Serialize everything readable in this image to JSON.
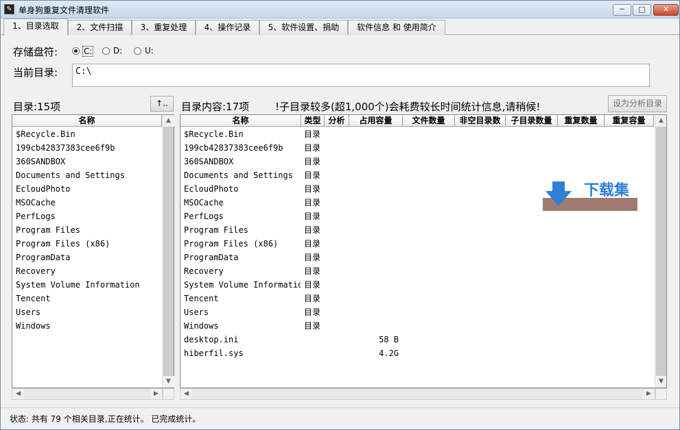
{
  "window": {
    "title": "单身狗重复文件清理软件",
    "min_glyph": "─",
    "max_glyph": "□",
    "close_glyph": "✕",
    "icon_glyph": "✎"
  },
  "tabs": [
    {
      "label": "1、目录选取",
      "active": true
    },
    {
      "label": "2、文件扫描",
      "active": false
    },
    {
      "label": "3、重复处理",
      "active": false
    },
    {
      "label": "4、操作记录",
      "active": false
    },
    {
      "label": "5、软件设置、捐助",
      "active": false
    },
    {
      "label": "软件信息 和 使用简介",
      "active": false
    }
  ],
  "drive": {
    "label": "存储盘符:",
    "options": [
      "C:",
      "D:",
      "U:"
    ],
    "selected": "C:"
  },
  "current_dir": {
    "label": "当前目录:",
    "value": "C:\\"
  },
  "left_panel": {
    "count_label": "目录:15项",
    "up_button": "↑..",
    "header": "名称",
    "items": [
      "$Recycle.Bin",
      "199cb42837383cee6f9b",
      "360SANDBOX",
      "Documents and Settings",
      "EcloudPhoto",
      "MSOCache",
      "PerfLogs",
      "Program Files",
      "Program Files (x86)",
      "ProgramData",
      "Recovery",
      "System Volume Information",
      "Tencent",
      "Users",
      "Windows"
    ]
  },
  "right_panel": {
    "count_label": "目录内容:17项",
    "warning": "!子目录较多(超1,000个)会耗费较长时间统计信息,请稍候!",
    "set_button": "设为分析目录",
    "headers": [
      "名称",
      "类型",
      "分析",
      "占用容量",
      "文件数量",
      "非空目录数",
      "子目录数量",
      "重复数量",
      "重复容量"
    ],
    "rows": [
      {
        "name": "$Recycle.Bin",
        "type": "目录",
        "size": ""
      },
      {
        "name": "199cb42837383cee6f9b",
        "type": "目录",
        "size": ""
      },
      {
        "name": "360SANDBOX",
        "type": "目录",
        "size": ""
      },
      {
        "name": "Documents and Settings",
        "type": "目录",
        "size": ""
      },
      {
        "name": "EcloudPhoto",
        "type": "目录",
        "size": ""
      },
      {
        "name": "MSOCache",
        "type": "目录",
        "size": ""
      },
      {
        "name": "PerfLogs",
        "type": "目录",
        "size": ""
      },
      {
        "name": "Program Files",
        "type": "目录",
        "size": ""
      },
      {
        "name": "Program Files (x86)",
        "type": "目录",
        "size": ""
      },
      {
        "name": "ProgramData",
        "type": "目录",
        "size": ""
      },
      {
        "name": "Recovery",
        "type": "目录",
        "size": ""
      },
      {
        "name": "System Volume Informatio",
        "type": "目录",
        "size": ""
      },
      {
        "name": "Tencent",
        "type": "目录",
        "size": ""
      },
      {
        "name": "Users",
        "type": "目录",
        "size": ""
      },
      {
        "name": "Windows",
        "type": "目录",
        "size": ""
      },
      {
        "name": "desktop.ini",
        "type": "",
        "size": "58 B"
      },
      {
        "name": "hiberfil.sys",
        "type": "",
        "size": "4.2G"
      }
    ]
  },
  "watermark": {
    "text": "下载集",
    "colors": {
      "arrow": "#2f7fd6",
      "bar": "#9e7a72"
    }
  },
  "status": {
    "text": "状态: 共有 79 个相关目录,正在统计。 已完成统计。"
  },
  "scroll_glyphs": {
    "up": "▲",
    "down": "▼",
    "left": "◀",
    "right": "▶"
  }
}
